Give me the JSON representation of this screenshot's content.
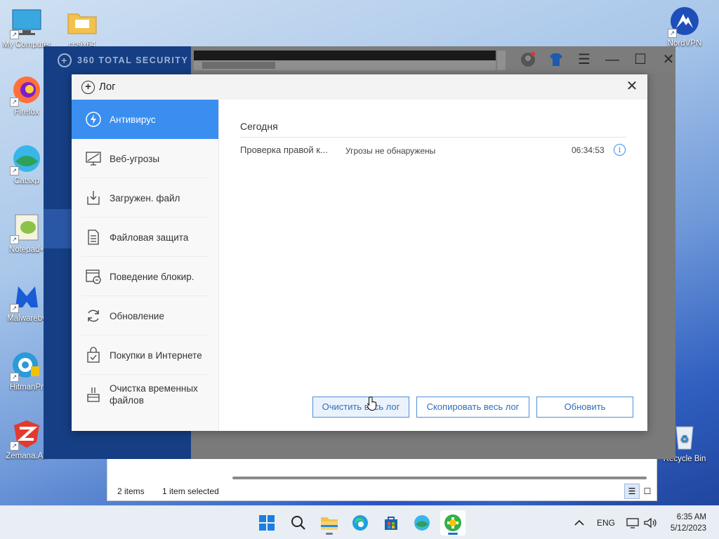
{
  "desktop": {
    "icons": [
      {
        "label": "My Computer",
        "icon": "monitor-icon"
      },
      {
        "label": "ccsix64",
        "icon": "folder-icon"
      },
      {
        "label": "Firefox",
        "icon": "firefox-icon"
      },
      {
        "label": "Catsxp",
        "icon": "catsxp-icon"
      },
      {
        "label": "Notepad+",
        "icon": "notepad-plus-icon"
      },
      {
        "label": "Malwareby",
        "icon": "malwarebytes-icon"
      },
      {
        "label": "HitmanPr",
        "icon": "hitmanpro-icon"
      },
      {
        "label": "Zemana.An",
        "icon": "zemana-icon"
      },
      {
        "label": "NordVPN",
        "icon": "nordvpn-icon"
      },
      {
        "label": "Recycle Bin",
        "icon": "recycle-bin-icon"
      }
    ]
  },
  "explorer": {
    "status_items": "2 items",
    "status_selected": "1 item selected"
  },
  "app": {
    "brand": "360 TOTAL SECURITY"
  },
  "dialog": {
    "title": "Лог",
    "nav": [
      {
        "label": "Антивирус",
        "icon": "antivirus-icon",
        "active": true
      },
      {
        "label": "Веб-угрозы",
        "icon": "web-threats-icon"
      },
      {
        "label": "Загружен. файл",
        "icon": "download-file-icon"
      },
      {
        "label": "Файловая защита",
        "icon": "file-protection-icon"
      },
      {
        "label": "Поведение блокир.",
        "icon": "behavior-block-icon"
      },
      {
        "label": "Обновление",
        "icon": "update-icon"
      },
      {
        "label": "Покупки в Интернете",
        "icon": "shopping-icon"
      },
      {
        "label": "Очистка временных файлов",
        "icon": "temp-cleanup-icon"
      }
    ],
    "section_title": "Сегодня",
    "log_rows": [
      {
        "event": "Проверка правой к...",
        "result": "Угрозы не обнаружены",
        "time": "06:34:53"
      }
    ],
    "buttons": {
      "clear": "Очистить весь лог",
      "copy": "Скопировать весь лог",
      "refresh": "Обновить"
    }
  },
  "taskbar": {
    "language": "ENG",
    "time": "6:35 AM",
    "date": "5/12/2023"
  },
  "colors": {
    "accent": "#3a8ef0",
    "app_sidebar": "#153e84",
    "button_text": "#2f6fb8"
  }
}
